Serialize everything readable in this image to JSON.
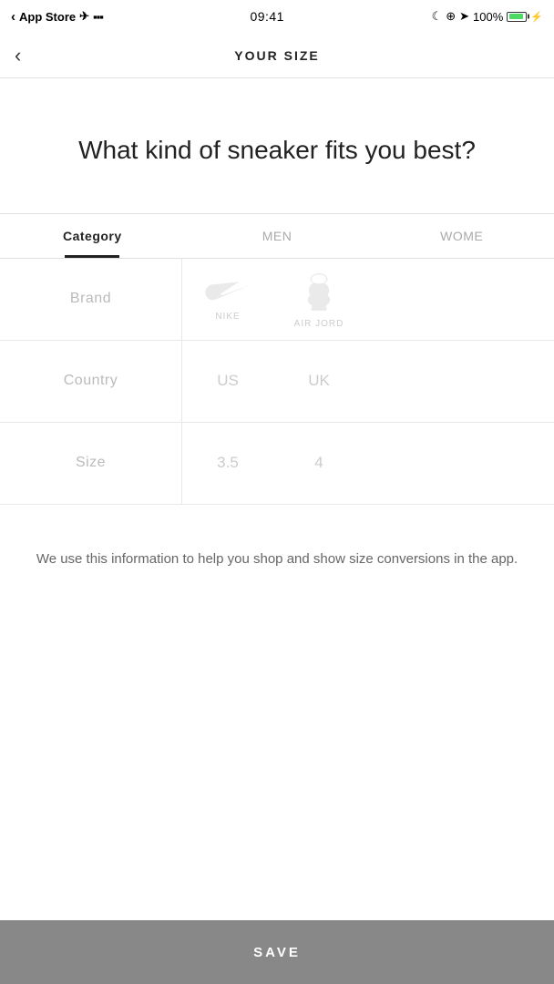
{
  "statusBar": {
    "appStore": "App Store",
    "time": "09:41",
    "battery": "100%"
  },
  "nav": {
    "title": "YOUR SIZE",
    "backLabel": "‹"
  },
  "hero": {
    "question": "What kind of sneaker fits you best?"
  },
  "tabs": [
    {
      "id": "category",
      "label": "Category",
      "active": true
    },
    {
      "id": "men",
      "label": "MEN",
      "active": false
    },
    {
      "id": "women",
      "label": "WOME",
      "active": false
    }
  ],
  "pickers": [
    {
      "label": "Brand",
      "type": "brand",
      "values": [
        "NIKE",
        "AIR JORD"
      ]
    },
    {
      "label": "Country",
      "type": "text",
      "values": [
        "US",
        "UK"
      ]
    },
    {
      "label": "Size",
      "type": "text",
      "values": [
        "3.5",
        "4"
      ]
    }
  ],
  "infoText": "We use this information to help you shop and show size conversions in the app.",
  "saveButton": {
    "label": "SAVE"
  }
}
